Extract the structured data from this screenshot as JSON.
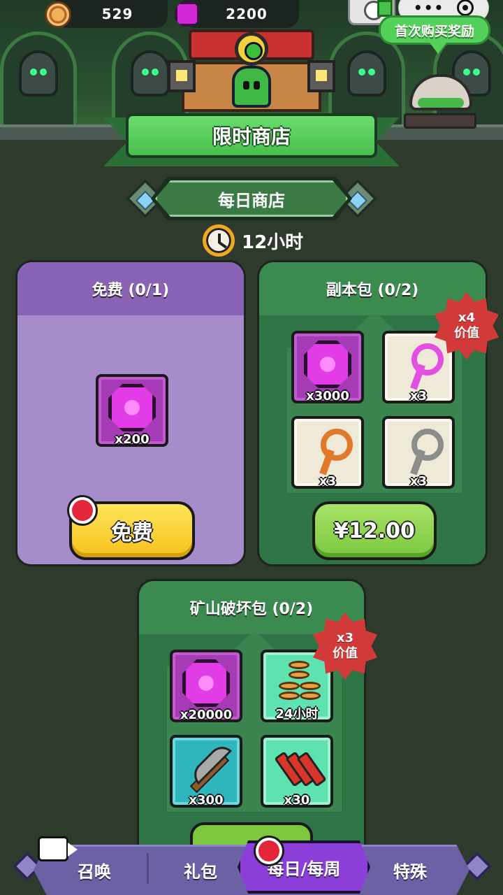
{
  "header": {
    "coins": "529",
    "gems": "2200",
    "first_buy_reward": "首次购买奖励",
    "menu_dots": "•••"
  },
  "shop": {
    "title": "限时商店",
    "subtitle": "每日商店",
    "timer": "12小时"
  },
  "cards": {
    "free": {
      "title": "免费 (0/1)",
      "item_qty": "x200",
      "button": "免费"
    },
    "dungeon": {
      "title": "副本包 (0/2)",
      "badge_line1": "x4",
      "badge_line2": "价值",
      "items": [
        "x3000",
        "x3",
        "x3",
        "x3"
      ],
      "price": "¥12.00"
    },
    "mine": {
      "title": "矿山破坏包 (0/2)",
      "badge_line1": "x3",
      "badge_line2": "价值",
      "items": [
        "x20000",
        "24小时",
        "x300",
        "x30"
      ]
    }
  },
  "nav": {
    "tabs": [
      "召唤",
      "礼包",
      "每日/每周",
      "特殊"
    ],
    "active_index": 2
  },
  "colors": {
    "card_free": "#a78ccb",
    "card_green": "#2f7445",
    "button_yellow": "#f5c21b",
    "button_green": "#7bc83e",
    "badge_red": "#d23a3a",
    "nav_active": "#8c3fd8"
  }
}
